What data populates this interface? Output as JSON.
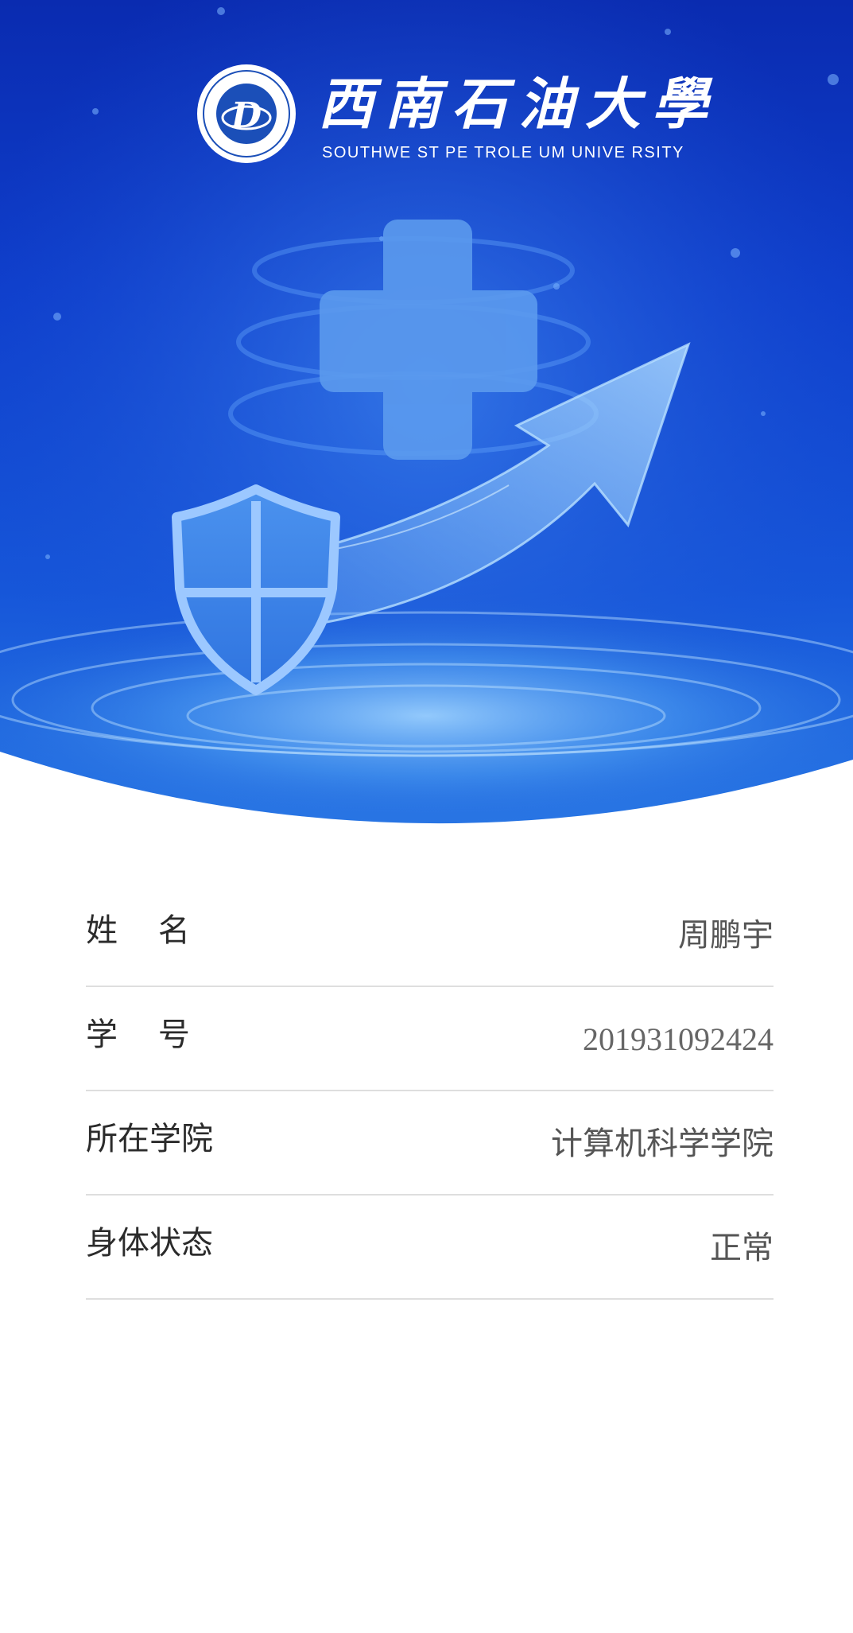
{
  "branding": {
    "university_name_cn": "西南石油大學",
    "university_name_en": "SOUTHWE ST PE TROLE UM UNIVE RSITY",
    "seal_icon": "university-seal-icon"
  },
  "hero": {
    "icons": [
      "medical-cross-icon",
      "shield-icon",
      "upward-arrow-icon"
    ],
    "colors": {
      "top": "#0c2fb8",
      "mid": "#1a56d8",
      "glow": "#5aa8f0"
    }
  },
  "info": {
    "rows": [
      {
        "label": "姓    名",
        "value": "周鹏宇"
      },
      {
        "label": "学    号",
        "value": "201931092424"
      },
      {
        "label": "所在学院",
        "value": "计算机科学学院"
      },
      {
        "label": "身体状态",
        "value": "正常"
      }
    ]
  }
}
